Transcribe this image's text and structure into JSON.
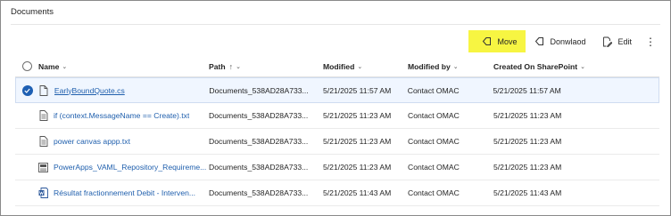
{
  "title": "Documents",
  "commands": {
    "move": "Move",
    "download": "Donwlaod",
    "edit": "Edit",
    "more": "⋮"
  },
  "columns": {
    "name": "Name",
    "path": "Path",
    "modified": "Modified",
    "modified_by": "Modified by",
    "created_on": "Created On SharePoint"
  },
  "rows": [
    {
      "name": "EarlyBoundQuote.cs",
      "path": "Documents_538AD28A733...",
      "modified": "5/21/2025 11:57 AM",
      "modified_by": "Contact OMAC",
      "created": "5/21/2025 11:57 AM",
      "icon": "file-icon"
    },
    {
      "name": "if (context.MessageName == Create).txt",
      "path": "Documents_538AD28A733...",
      "modified": "5/21/2025 11:23 AM",
      "modified_by": "Contact OMAC",
      "created": "5/21/2025 11:23 AM",
      "icon": "text-file-icon"
    },
    {
      "name": "power canvas appp.txt",
      "path": "Documents_538AD28A733...",
      "modified": "5/21/2025 11:23 AM",
      "modified_by": "Contact OMAC",
      "created": "5/21/2025 11:23 AM",
      "icon": "text-file-icon"
    },
    {
      "name": "PowerApps_VAML_Repository_Requireme...",
      "path": "Documents_538AD28A733...",
      "modified": "5/21/2025 11:23 AM",
      "modified_by": "Contact OMAC",
      "created": "5/21/2025 11:23 AM",
      "icon": "generic-document-icon"
    },
    {
      "name": "Résultat fractionnement Debit - Interven...",
      "path": "Documents_538AD28A733...",
      "modified": "5/21/2025 11:43 AM",
      "modified_by": "Contact OMAC",
      "created": "5/21/2025 11:43 AM",
      "icon": "word-document-icon"
    }
  ],
  "colors": {
    "highlight": "#f7f542",
    "link": "#1f5fad",
    "selected_check": "#1d5fb3"
  }
}
